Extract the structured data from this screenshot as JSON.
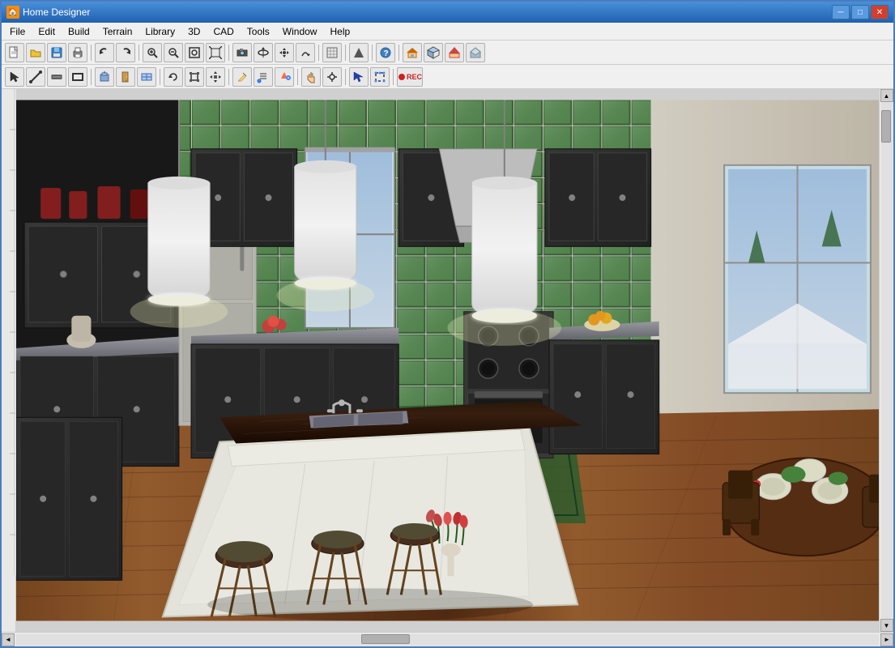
{
  "window": {
    "title": "Home Designer",
    "icon": "🏠"
  },
  "title_bar": {
    "title": "Home Designer",
    "minimize_label": "─",
    "restore_label": "□",
    "close_label": "✕"
  },
  "menu_bar": {
    "items": [
      {
        "id": "file",
        "label": "File"
      },
      {
        "id": "edit",
        "label": "Edit"
      },
      {
        "id": "build",
        "label": "Build"
      },
      {
        "id": "terrain",
        "label": "Terrain"
      },
      {
        "id": "library",
        "label": "Library"
      },
      {
        "id": "3d",
        "label": "3D"
      },
      {
        "id": "cad",
        "label": "CAD"
      },
      {
        "id": "tools",
        "label": "Tools"
      },
      {
        "id": "window",
        "label": "Window"
      },
      {
        "id": "help",
        "label": "Help"
      }
    ]
  },
  "toolbar1": {
    "buttons": [
      "new",
      "open",
      "save",
      "print",
      "separator",
      "undo",
      "redo",
      "separator",
      "zoom-out",
      "zoom-in",
      "zoom-window",
      "zoom-fit",
      "separator",
      "camera",
      "camera-orbit",
      "camera-pan",
      "camera-tilt",
      "separator",
      "reference-grid",
      "separator",
      "arrow-up",
      "separator",
      "question",
      "separator",
      "house",
      "house-3d",
      "house-roof",
      "house-floor"
    ]
  },
  "toolbar2": {
    "buttons": [
      "select",
      "draw-line",
      "draw-wall",
      "draw-rect",
      "separator",
      "place-object",
      "place-door",
      "place-window",
      "separator",
      "rotate",
      "resize",
      "move",
      "separator",
      "pencil",
      "brush",
      "paint",
      "separator",
      "hand",
      "snap",
      "separator",
      "arrow",
      "transform",
      "separator",
      "rec"
    ]
  },
  "scene": {
    "description": "3D Kitchen interior render showing dark cabinets, green tile backsplash, wood floors, kitchen island with sink, pendant lights, bar stools, and dining table"
  },
  "scrollbars": {
    "vertical_up": "▲",
    "vertical_down": "▼",
    "horizontal_left": "◄",
    "horizontal_right": "►"
  }
}
